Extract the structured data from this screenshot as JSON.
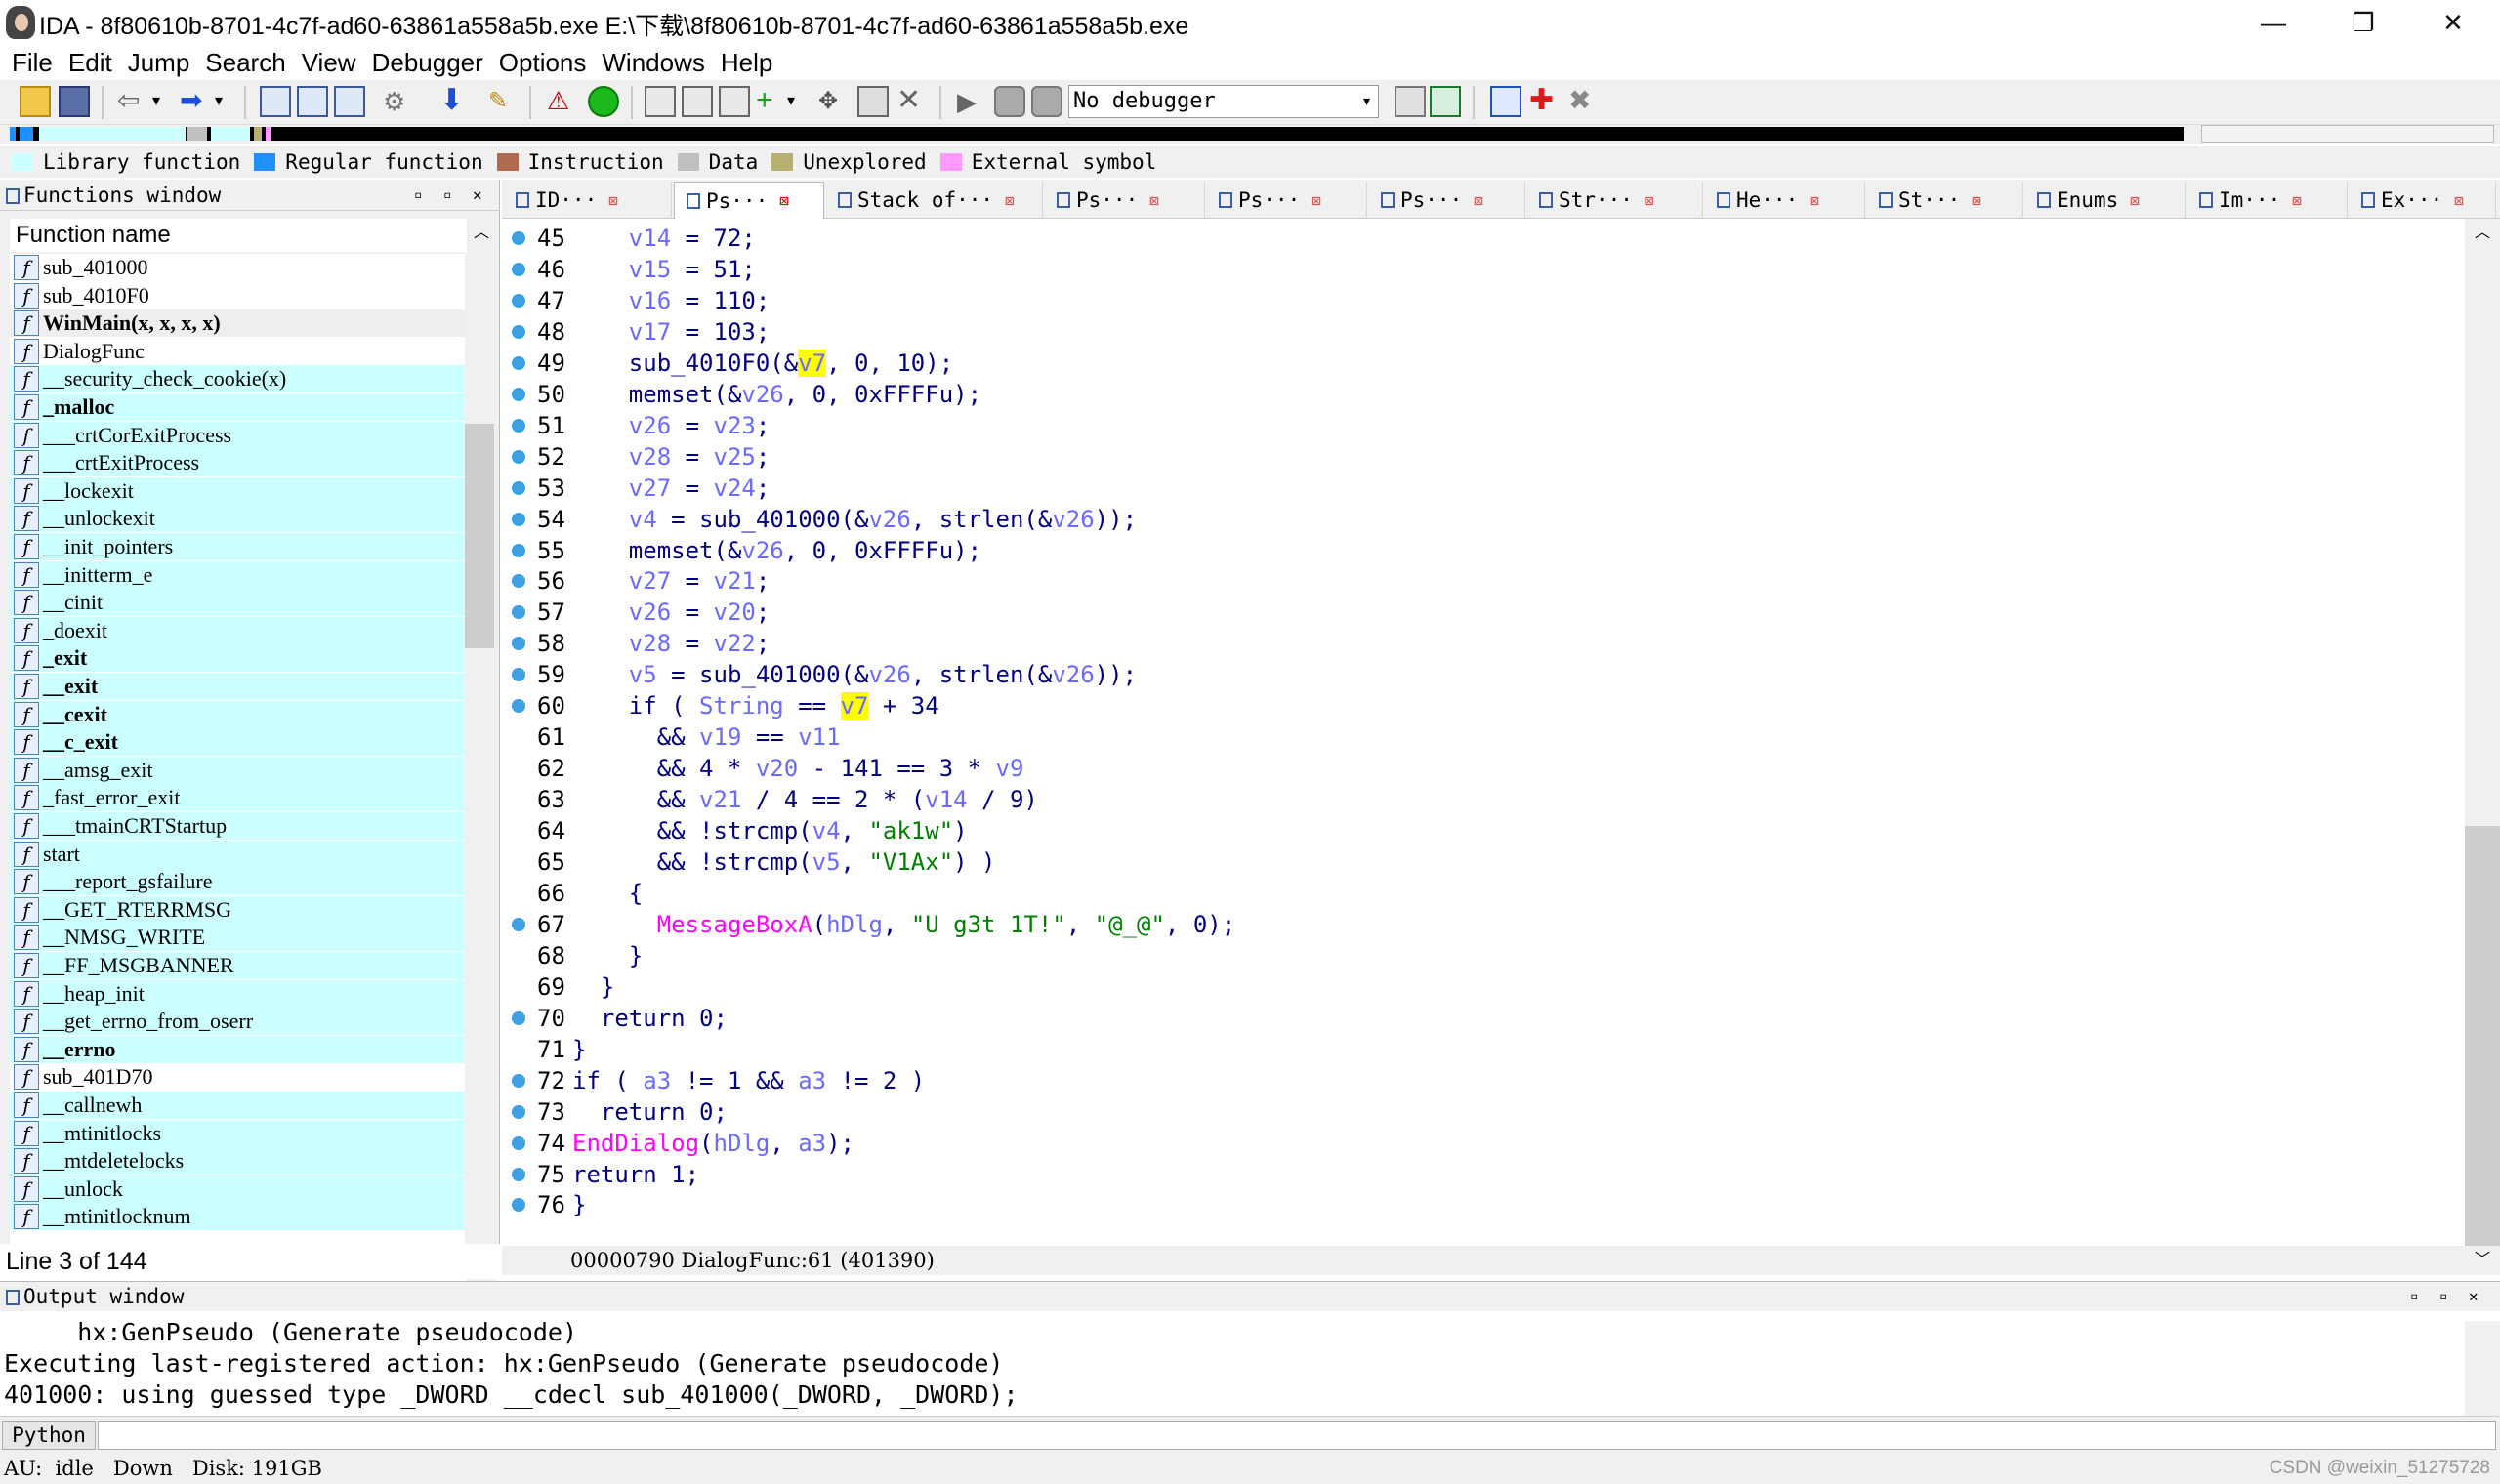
{
  "window": {
    "title": "IDA - 8f80610b-8701-4c7f-ad60-63861a558a5b.exe E:\\下载\\8f80610b-8701-4c7f-ad60-63861a558a5b.exe",
    "minimize": "—",
    "restore": "❐",
    "close": "✕"
  },
  "menu": [
    "File",
    "Edit",
    "Jump",
    "Search",
    "View",
    "Debugger",
    "Options",
    "Windows",
    "Help"
  ],
  "toolbar": {
    "debugger_select": "No debugger"
  },
  "legend": [
    {
      "label": "Library function",
      "color": "#ccffff"
    },
    {
      "label": "Regular function",
      "color": "#1e90ff"
    },
    {
      "label": "Instruction",
      "color": "#b06a50"
    },
    {
      "label": "Data",
      "color": "#c0c0c0"
    },
    {
      "label": "Unexplored",
      "color": "#b8b070"
    },
    {
      "label": "External symbol",
      "color": "#ff99ff"
    }
  ],
  "functions_window": {
    "title": "Functions window",
    "header": "Function name",
    "items": [
      {
        "name": "sub_401000",
        "kind": "regular"
      },
      {
        "name": "sub_4010F0",
        "kind": "regular"
      },
      {
        "name": "WinMain(x, x, x, x)",
        "kind": "selected"
      },
      {
        "name": "DialogFunc",
        "kind": "regular"
      },
      {
        "name": "__security_check_cookie(x)",
        "kind": "lib"
      },
      {
        "name": "_malloc",
        "kind": "libbold"
      },
      {
        "name": "___crtCorExitProcess",
        "kind": "lib"
      },
      {
        "name": "___crtExitProcess",
        "kind": "lib"
      },
      {
        "name": "__lockexit",
        "kind": "lib"
      },
      {
        "name": "__unlockexit",
        "kind": "lib"
      },
      {
        "name": "__init_pointers",
        "kind": "lib"
      },
      {
        "name": "__initterm_e",
        "kind": "lib"
      },
      {
        "name": "__cinit",
        "kind": "lib"
      },
      {
        "name": "_doexit",
        "kind": "lib"
      },
      {
        "name": "_exit",
        "kind": "libbold"
      },
      {
        "name": "__exit",
        "kind": "libbold"
      },
      {
        "name": "__cexit",
        "kind": "libbold"
      },
      {
        "name": "__c_exit",
        "kind": "libbold"
      },
      {
        "name": "__amsg_exit",
        "kind": "lib"
      },
      {
        "name": "_fast_error_exit",
        "kind": "lib"
      },
      {
        "name": "___tmainCRTStartup",
        "kind": "lib"
      },
      {
        "name": "start",
        "kind": "lib"
      },
      {
        "name": "___report_gsfailure",
        "kind": "lib"
      },
      {
        "name": "__GET_RTERRMSG",
        "kind": "lib"
      },
      {
        "name": "__NMSG_WRITE",
        "kind": "lib"
      },
      {
        "name": "__FF_MSGBANNER",
        "kind": "lib"
      },
      {
        "name": "__heap_init",
        "kind": "lib"
      },
      {
        "name": "__get_errno_from_oserr",
        "kind": "lib"
      },
      {
        "name": "__errno",
        "kind": "libbold"
      },
      {
        "name": "sub_401D70",
        "kind": "regular"
      },
      {
        "name": "__callnewh",
        "kind": "lib"
      },
      {
        "name": "__mtinitlocks",
        "kind": "lib"
      },
      {
        "name": "__mtdeletelocks",
        "kind": "lib"
      },
      {
        "name": "__unlock",
        "kind": "lib"
      },
      {
        "name": "__mtinitlocknum",
        "kind": "lib"
      }
    ],
    "line_info": "Line 3 of 144"
  },
  "tabs": [
    {
      "label": "ID···",
      "active": false
    },
    {
      "label": "Ps···",
      "active": true
    },
    {
      "label": "Stack of···",
      "active": false
    },
    {
      "label": "Ps···",
      "active": false
    },
    {
      "label": "Ps···",
      "active": false
    },
    {
      "label": "Ps···",
      "active": false
    },
    {
      "label": "Str···",
      "active": false
    },
    {
      "label": "He···",
      "active": false
    },
    {
      "label": "St···",
      "active": false
    },
    {
      "label": "Enums",
      "active": false
    },
    {
      "label": "Im···",
      "active": false
    },
    {
      "label": "Ex···",
      "active": false
    }
  ],
  "code": [
    {
      "n": "45",
      "dot": true,
      "html": "    <span class=\"v\">v14</span> = 72;"
    },
    {
      "n": "46",
      "dot": true,
      "html": "    <span class=\"v\">v15</span> = 51;"
    },
    {
      "n": "47",
      "dot": true,
      "html": "    <span class=\"v\">v16</span> = 110;"
    },
    {
      "n": "48",
      "dot": true,
      "html": "    <span class=\"v\">v17</span> = 103;"
    },
    {
      "n": "49",
      "dot": true,
      "html": "    sub_4010F0(&amp;<span class=\"v hl\">v7</span>, 0, 10);"
    },
    {
      "n": "50",
      "dot": true,
      "html": "    memset(&amp;<span class=\"v\">v26</span>, 0, 0xFFFFu);"
    },
    {
      "n": "51",
      "dot": true,
      "html": "    <span class=\"v\">v26</span> = <span class=\"v\">v23</span>;"
    },
    {
      "n": "52",
      "dot": true,
      "html": "    <span class=\"v\">v28</span> = <span class=\"v\">v25</span>;"
    },
    {
      "n": "53",
      "dot": true,
      "html": "    <span class=\"v\">v27</span> = <span class=\"v\">v24</span>;"
    },
    {
      "n": "54",
      "dot": true,
      "html": "    <span class=\"v\">v4</span> = sub_401000(&amp;<span class=\"v\">v26</span>, strlen(&amp;<span class=\"v\">v26</span>));"
    },
    {
      "n": "55",
      "dot": true,
      "html": "    memset(&amp;<span class=\"v\">v26</span>, 0, 0xFFFFu);"
    },
    {
      "n": "56",
      "dot": true,
      "html": "    <span class=\"v\">v27</span> = <span class=\"v\">v21</span>;"
    },
    {
      "n": "57",
      "dot": true,
      "html": "    <span class=\"v\">v26</span> = <span class=\"v\">v20</span>;"
    },
    {
      "n": "58",
      "dot": true,
      "html": "    <span class=\"v\">v28</span> = <span class=\"v\">v22</span>;"
    },
    {
      "n": "59",
      "dot": true,
      "html": "    <span class=\"v\">v5</span> = sub_401000(&amp;<span class=\"v\">v26</span>, strlen(&amp;<span class=\"v\">v26</span>));"
    },
    {
      "n": "60",
      "dot": true,
      "html": "    if ( <span class=\"v\">String</span> == <span class=\"v hl\">v7</span> + 34"
    },
    {
      "n": "61",
      "dot": false,
      "html": "      &amp;&amp; <span class=\"v\">v19</span> == <span class=\"v\">v11</span>"
    },
    {
      "n": "62",
      "dot": false,
      "html": "      &amp;&amp; 4 * <span class=\"v\">v20</span> - 141 == 3 * <span class=\"v\">v9</span>"
    },
    {
      "n": "63",
      "dot": false,
      "html": "      &amp;&amp; <span class=\"v\">v21</span> / 4 == 2 * (<span class=\"v\">v14</span> / 9)"
    },
    {
      "n": "64",
      "dot": false,
      "html": "      &amp;&amp; !strcmp(<span class=\"v\">v4</span>, <span class=\"str\">\"ak1w\"</span>)"
    },
    {
      "n": "65",
      "dot": false,
      "html": "      &amp;&amp; !strcmp(<span class=\"v\">v5</span>, <span class=\"str\">\"V1Ax\"</span>) )"
    },
    {
      "n": "66",
      "dot": false,
      "html": "    {"
    },
    {
      "n": "67",
      "dot": true,
      "html": "      <span class=\"api\">MessageBoxA</span>(<span class=\"v\">hDlg</span>, <span class=\"str\">\"U g3t 1T!\"</span>, <span class=\"str\">\"@_@\"</span>, 0);"
    },
    {
      "n": "68",
      "dot": false,
      "html": "    }"
    },
    {
      "n": "69",
      "dot": false,
      "html": "  }"
    },
    {
      "n": "70",
      "dot": true,
      "html": "  return 0;"
    },
    {
      "n": "71",
      "dot": false,
      "html": "}"
    },
    {
      "n": "72",
      "dot": true,
      "html": "if ( <span class=\"v\">a3</span> != 1 &amp;&amp; <span class=\"v\">a3</span> != 2 )"
    },
    {
      "n": "73",
      "dot": true,
      "html": "  return 0;"
    },
    {
      "n": "74",
      "dot": true,
      "html": "<span class=\"api\">EndDialog</span>(<span class=\"v\">hDlg</span>, <span class=\"v\">a3</span>);"
    },
    {
      "n": "75",
      "dot": true,
      "html": "return 1;"
    },
    {
      "n": "76",
      "dot": true,
      "html": "}"
    }
  ],
  "code_status": "00000790 DialogFunc:61 (401390)",
  "output": {
    "title": "Output window",
    "lines": [
      "     hx:GenPseudo (Generate pseudocode)",
      "Executing last-registered action: hx:GenPseudo (Generate pseudocode)",
      "401000: using guessed type _DWORD __cdecl sub_401000(_DWORD, _DWORD);"
    ],
    "python_label": "Python"
  },
  "status": {
    "text": "AU:  idle   Down   Disk: 191GB"
  },
  "watermark": "CSDN @weixin_51275728"
}
